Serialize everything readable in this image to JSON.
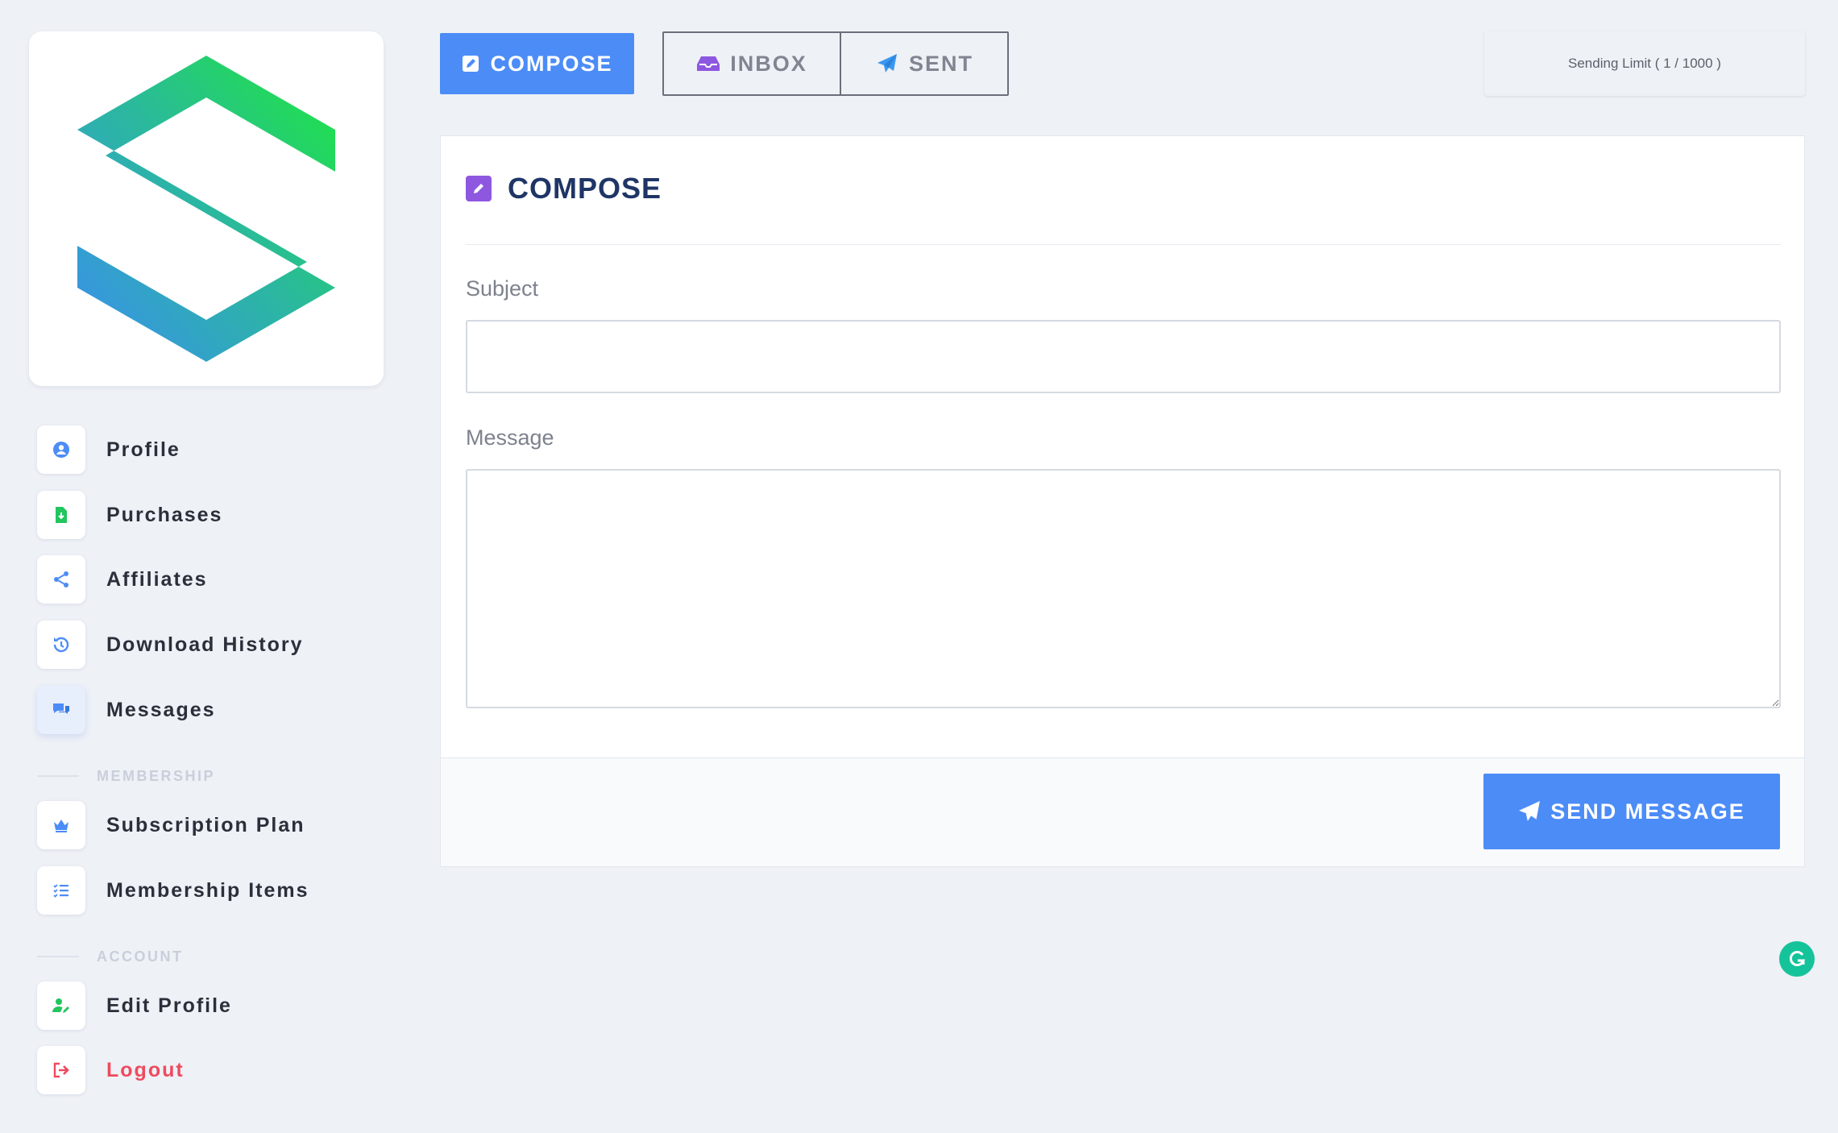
{
  "sidebar": {
    "items": [
      {
        "label": "Profile",
        "icon": "user-circle-icon"
      },
      {
        "label": "Purchases",
        "icon": "file-download-icon"
      },
      {
        "label": "Affiliates",
        "icon": "share-icon"
      },
      {
        "label": "Download History",
        "icon": "history-icon"
      },
      {
        "label": "Messages",
        "icon": "comments-icon"
      }
    ],
    "sections": [
      {
        "title": "MEMBERSHIP",
        "items": [
          {
            "label": "Subscription Plan",
            "icon": "crown-icon"
          },
          {
            "label": "Membership Items",
            "icon": "checklist-icon"
          }
        ]
      },
      {
        "title": "ACCOUNT",
        "items": [
          {
            "label": "Edit Profile",
            "icon": "user-edit-icon"
          },
          {
            "label": "Logout",
            "icon": "sign-out-icon"
          }
        ]
      }
    ]
  },
  "tabs": {
    "compose": "COMPOSE",
    "inbox": "INBOX",
    "sent": "SENT"
  },
  "sending_limit": "Sending Limit ( 1 / 1000 )",
  "compose_card": {
    "title": "COMPOSE",
    "subject_label": "Subject",
    "subject_value": "",
    "message_label": "Message",
    "message_value": "",
    "send_button": "SEND MESSAGE"
  },
  "colors": {
    "primary": "#4c8cf7",
    "accent_purple": "#8e57e0",
    "logout_red": "#ef4a5e",
    "title_navy": "#1f3566",
    "grammarly": "#15c39a"
  }
}
